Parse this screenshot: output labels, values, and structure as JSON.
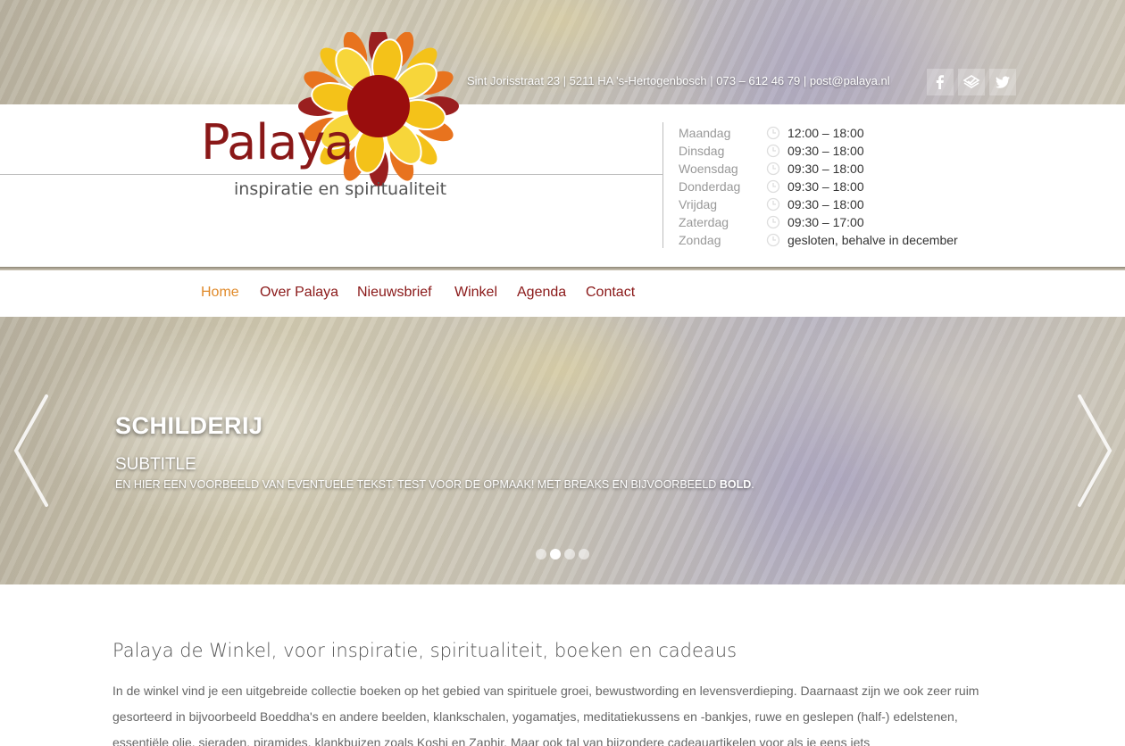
{
  "header": {
    "address": "Sint Jorisstraat 23 | 5211 HA 's-Hertogenbosch | 073 – 612 46 79 | post@palaya.nl",
    "logo_text": "Palaya",
    "tagline": "inspiratie en spiritualiteit",
    "social": [
      {
        "name": "facebook-icon",
        "glyph": "f"
      },
      {
        "name": "foursquare-icon",
        "glyph": ""
      },
      {
        "name": "twitter-icon",
        "glyph": ""
      }
    ],
    "colors": {
      "brand": "#8a1818",
      "accent": "#e08a2a",
      "petal": "#f4c219"
    }
  },
  "hours": [
    {
      "day": "Maandag",
      "time": "12:00 – 18:00"
    },
    {
      "day": "Dinsdag",
      "time": "09:30 – 18:00"
    },
    {
      "day": "Woensdag",
      "time": "09:30 – 18:00"
    },
    {
      "day": "Donderdag",
      "time": "09:30 – 18:00"
    },
    {
      "day": "Vrijdag",
      "time": "09:30 – 18:00"
    },
    {
      "day": "Zaterdag",
      "time": "09:30 – 17:00"
    },
    {
      "day": "Zondag",
      "time": "gesloten, behalve in december"
    }
  ],
  "nav": [
    "Home",
    "Over Palaya",
    "Nieuwsbrief",
    "Winkel",
    "Agenda",
    "Contact"
  ],
  "nav_active": "Home",
  "slider": {
    "title": "SCHILDERIJ",
    "subtitle": "SUBTITLE",
    "text": "EN HIER EEN VOORBEELD VAN EVENTUELE TEKST. TEST VOOR DE OPMAAK! MET BREAKS EN BIJVOORBEELD ",
    "text_bold": "BOLD",
    "text_end": ".",
    "dot_count": 4,
    "active_dot": 2
  },
  "content": {
    "title": "Palaya de Winkel, voor inspiratie, spiritualiteit, boeken en cadeaus",
    "paragraph": "In de winkel vind je een uitgebreide collectie boeken op het gebied van spirituele groei, bewustwording en levensverdieping. Daarnaast zijn we ook zeer ruim gesorteerd in bijvoorbeeld Boeddha's en andere beelden, klankschalen, yogamatjes, meditatiekussens en -bankjes, ruwe en geslepen (half-) edelstenen, essentiële olie, sieraden, piramides, klankbuizen zoals Koshi en Zaphir. Maar ook tal van bijzondere cadeauartikelen voor als je eens iets"
  }
}
